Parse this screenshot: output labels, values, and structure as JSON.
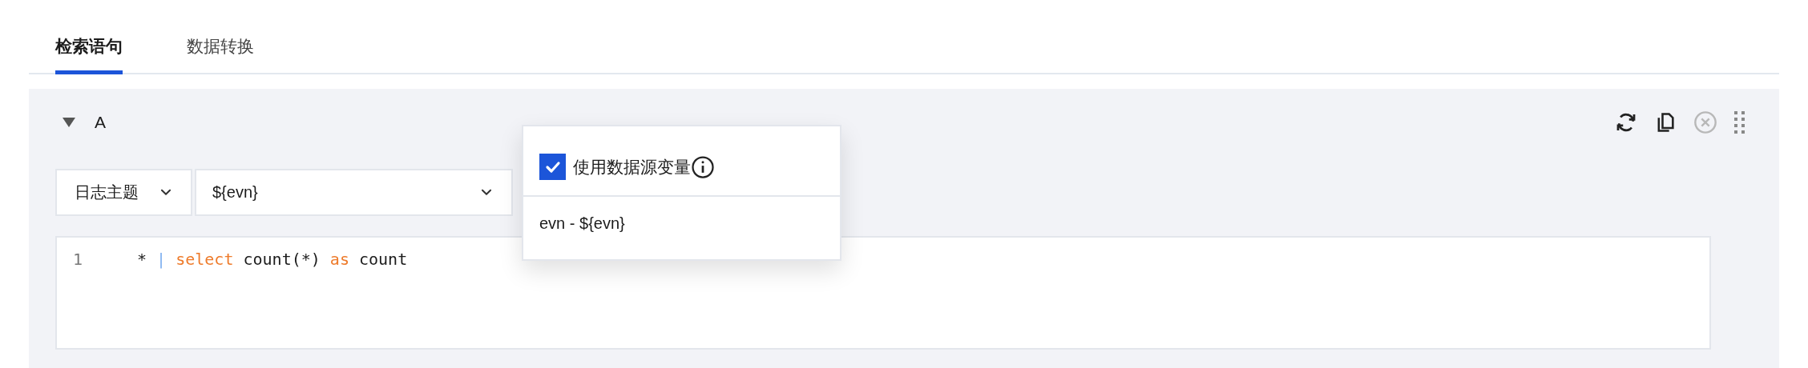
{
  "tabs": [
    {
      "label": "检索语句",
      "selected": true
    },
    {
      "label": "数据转换",
      "selected": false
    }
  ],
  "query": {
    "name": "A",
    "expanded": true,
    "source_select": {
      "value": "日志主题"
    },
    "topic_select": {
      "value": "${evn}"
    },
    "editor": {
      "lines": [
        {
          "number": "1",
          "tokens": [
            {
              "kind": "plain",
              "text": "*"
            },
            {
              "kind": "operator",
              "text": "|"
            },
            {
              "kind": "keyword",
              "text": "select"
            },
            {
              "kind": "plain",
              "text": "count(*)"
            },
            {
              "kind": "keyword",
              "text": "as"
            },
            {
              "kind": "plain",
              "text": "count"
            }
          ]
        }
      ]
    }
  },
  "popover": {
    "checkbox": {
      "label": "使用数据源变量",
      "checked": true
    },
    "options": [
      {
        "label": "evn - ${evn}"
      }
    ]
  }
}
